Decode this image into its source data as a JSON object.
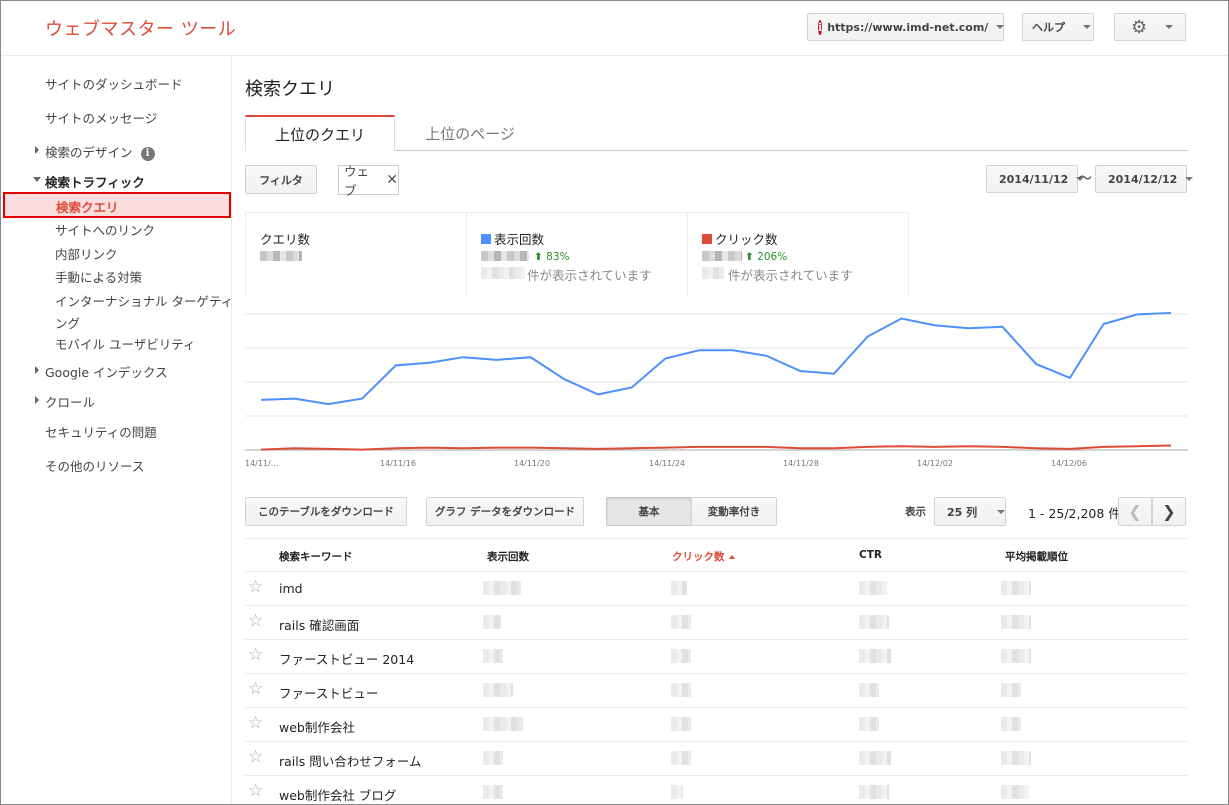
{
  "header": {
    "app_title": "ウェブマスター ツール",
    "site_url": "https://www.imd-net.com/",
    "help_label": "ヘルプ"
  },
  "sidebar": {
    "dashboard": "サイトのダッシュボード",
    "messages": "サイトのメッセージ",
    "search_appearance": "検索のデザイン",
    "search_traffic": "検索トラフィック",
    "search_queries": "検索クエリ",
    "links_to_site": "サイトへのリンク",
    "internal_links": "内部リンク",
    "manual_actions": "手動による対策",
    "intl_targeting_1": "インターナショナル ターゲティ",
    "intl_targeting_2": "ング",
    "mobile_usability": "モバイル ユーザビリティ",
    "google_index": "Google インデックス",
    "crawl": "クロール",
    "security": "セキュリティの問題",
    "other_resources": "その他のリソース"
  },
  "main": {
    "page_title": "検索クエリ",
    "tabs": [
      {
        "label": "上位のクエリ"
      },
      {
        "label": "上位のページ"
      }
    ],
    "filter_label": "フィルタ",
    "chip_label": "ウェブ",
    "date_from": "2014/11/12",
    "date_to": "2014/12/12",
    "date_sep": "〜"
  },
  "stats": {
    "queries_label": "クエリ数",
    "impressions_label": "表示回数",
    "impressions_change": "83%",
    "impressions_sub": "件が表示されています",
    "clicks_label": "クリック数",
    "clicks_change": "206%",
    "clicks_sub": "件が表示されています"
  },
  "colors": {
    "brand_red": "#dd4b39",
    "impressions_blue": "#4d90fe",
    "clicks_red": "#dd4b39"
  },
  "chart_data": {
    "type": "line",
    "x_tick_labels": [
      "14/11/...",
      "14/11/16",
      "14/11/20",
      "14/11/24",
      "14/11/28",
      "14/12/02",
      "14/12/06"
    ],
    "series": [
      {
        "name": "表示回数",
        "values": [
          0.37,
          0.38,
          0.34,
          0.38,
          0.62,
          0.64,
          0.68,
          0.66,
          0.68,
          0.52,
          0.41,
          0.46,
          0.67,
          0.73,
          0.73,
          0.69,
          0.58,
          0.56,
          0.83,
          0.96,
          0.91,
          0.89,
          0.9,
          0.63,
          0.53,
          0.92,
          0.99,
          1.0
        ]
      },
      {
        "name": "クリック数",
        "values": [
          0.01,
          0.02,
          0.015,
          0.01,
          0.02,
          0.025,
          0.02,
          0.025,
          0.025,
          0.02,
          0.015,
          0.02,
          0.025,
          0.03,
          0.03,
          0.03,
          0.02,
          0.02,
          0.03,
          0.035,
          0.03,
          0.035,
          0.03,
          0.02,
          0.015,
          0.03,
          0.035,
          0.04
        ]
      }
    ]
  },
  "controls": {
    "download_table": "このテーブルをダウンロード",
    "download_chart": "グラフ データをダウンロード",
    "basic": "基本",
    "with_change": "変動率付き",
    "show_label": "表示",
    "rows_value": "25 列",
    "page_info": "1 - 25/2,208 件"
  },
  "table": {
    "headers": {
      "keyword": "検索キーワード",
      "impressions": "表示回数",
      "clicks": "クリック数",
      "ctr": "CTR",
      "avg_position": "平均掲載順位"
    },
    "rows": [
      {
        "keyword": "imd"
      },
      {
        "keyword": "rails 確認画面"
      },
      {
        "keyword": "ファーストビュー 2014"
      },
      {
        "keyword": "ファーストビュー"
      },
      {
        "keyword": "web制作会社"
      },
      {
        "keyword": "rails 問い合わせフォーム"
      },
      {
        "keyword": "web制作会社 ブログ"
      }
    ]
  }
}
